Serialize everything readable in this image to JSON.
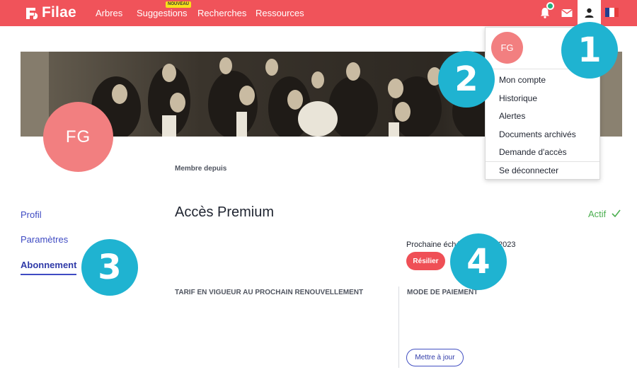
{
  "brand": {
    "name": "Filae",
    "colors": {
      "topbar": "#f0535a",
      "accent": "#3f4bc3",
      "callout": "#1fb3d1",
      "avatar": "#f27f80",
      "success": "#4caf50"
    }
  },
  "nav": {
    "items": [
      "Arbres",
      "Suggestions",
      "Recherches",
      "Ressources"
    ],
    "badge": "NOUVEAU"
  },
  "header_icons": {
    "bell": "bell-icon",
    "mail": "mail-icon",
    "user": "user-icon",
    "flag": "flag-fr-icon"
  },
  "profile": {
    "initials": "FG",
    "member_since_label": "Membre depuis"
  },
  "sidebar": {
    "items": [
      "Profil",
      "Paramètres",
      "Abonnement"
    ],
    "active": "Abonnement"
  },
  "subscription": {
    "title": "Accès Premium",
    "status": "Actif",
    "next_due_label": "Prochaine éché",
    "next_due_year_fragment": "2023",
    "cancel_button": "Résilier",
    "tariff_heading": "TARIF EN VIGUEUR AU PROCHAIN RENOUVELLEMENT",
    "payment_heading": "MODE DE PAIEMENT",
    "update_button": "Mettre à jour"
  },
  "menu": {
    "initials": "FG",
    "items": [
      "Mon compte",
      "Historique",
      "Alertes",
      "Documents archivés",
      "Demande d'accès",
      "Se déconnecter"
    ]
  },
  "callouts": [
    "1",
    "2",
    "3",
    "4"
  ]
}
